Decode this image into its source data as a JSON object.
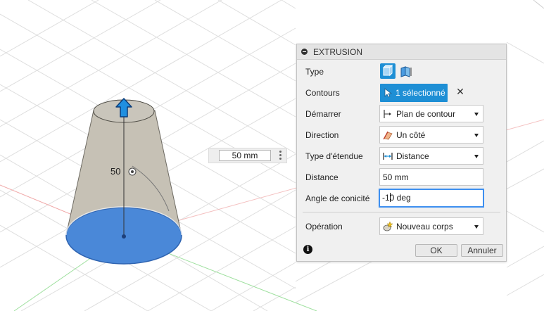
{
  "canvas": {
    "dimension_label": "50",
    "dimension_input_value": "50 mm"
  },
  "dialog": {
    "title": "EXTRUSION",
    "rows": {
      "type": {
        "label": "Type",
        "icons": [
          "extrude-solid-icon",
          "extrude-surface-icon"
        ]
      },
      "contours": {
        "label": "Contours",
        "selection": "1 sélectionné"
      },
      "start": {
        "label": "Démarrer",
        "value": "Plan de contour",
        "icon": "profile-plane-icon"
      },
      "direction": {
        "label": "Direction",
        "value": "Un côté",
        "icon": "one-side-icon"
      },
      "extent_type": {
        "label": "Type d'étendue",
        "value": "Distance",
        "icon": "distance-icon"
      },
      "distance": {
        "label": "Distance",
        "value": "50 mm"
      },
      "taper": {
        "label": "Angle de conicité",
        "value_before": "-1",
        "value_after": "0 deg"
      },
      "operation": {
        "label": "Opération",
        "value": "Nouveau corps",
        "icon": "new-body-icon"
      }
    },
    "buttons": {
      "ok": "OK",
      "cancel": "Annuler"
    }
  },
  "colors": {
    "accent": "#1e8fd5",
    "face_blue": "#4a88d8",
    "body_gray": "#c9c4b8",
    "grid_line": "#d9d9d9",
    "axis_red": "#e89a9a",
    "axis_green": "#8fd48f"
  }
}
